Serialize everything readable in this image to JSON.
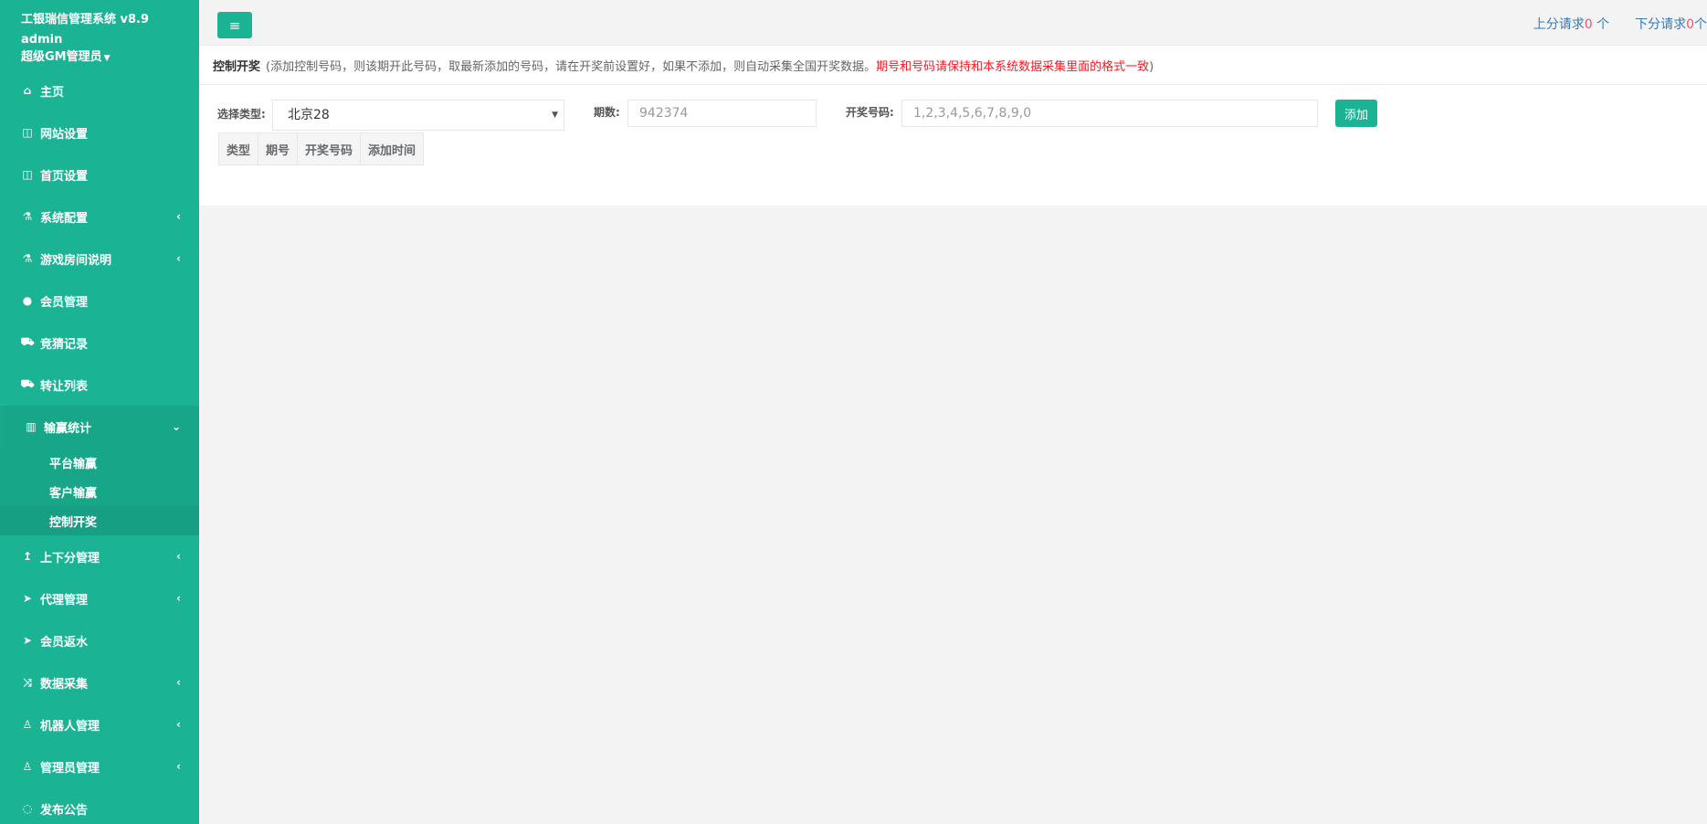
{
  "brand": {
    "title": "工银瑞信管理系统 v8.9",
    "username": "admin",
    "role": "超级GM管理员"
  },
  "sidebar": {
    "items": [
      {
        "label": "主页",
        "icon": "home-icon",
        "glyph": "⌂",
        "arrow": ""
      },
      {
        "label": "网站设置",
        "icon": "columns-icon",
        "glyph": "◫",
        "arrow": ""
      },
      {
        "label": "首页设置",
        "icon": "columns-icon",
        "glyph": "◫",
        "arrow": ""
      },
      {
        "label": "系统配置",
        "icon": "flask-icon",
        "glyph": "⚗",
        "arrow": "‹"
      },
      {
        "label": "游戏房间说明",
        "icon": "flask-icon",
        "glyph": "⚗",
        "arrow": "‹"
      },
      {
        "label": "会员管理",
        "icon": "user-icon",
        "glyph": "●",
        "arrow": ""
      },
      {
        "label": "竞猜记录",
        "icon": "taxi-icon",
        "glyph": "⛟",
        "arrow": ""
      },
      {
        "label": "转让列表",
        "icon": "taxi-icon",
        "glyph": "⛟",
        "arrow": ""
      },
      {
        "label": "输赢统计",
        "icon": "bar-chart-icon",
        "glyph": "▥",
        "arrow": "⌄"
      }
    ],
    "sub_items": [
      {
        "label": "平台输赢"
      },
      {
        "label": "客户输赢"
      },
      {
        "label": "控制开奖"
      }
    ],
    "items_after": [
      {
        "label": "上下分管理",
        "icon": "level-up-icon",
        "glyph": "↥",
        "arrow": "‹"
      },
      {
        "label": "代理管理",
        "icon": "paper-plane-icon",
        "glyph": "➤",
        "arrow": "‹"
      },
      {
        "label": "会员返水",
        "icon": "paper-plane-icon",
        "glyph": "➤",
        "arrow": ""
      },
      {
        "label": "数据采集",
        "icon": "random-icon",
        "glyph": "⤨",
        "arrow": "‹"
      },
      {
        "label": "机器人管理",
        "icon": "male-icon",
        "glyph": "♙",
        "arrow": "‹"
      },
      {
        "label": "管理员管理",
        "icon": "male-icon",
        "glyph": "♙",
        "arrow": "‹"
      },
      {
        "label": "发布公告",
        "icon": "comment-icon",
        "glyph": "◌",
        "arrow": ""
      }
    ]
  },
  "topbar": {
    "menu_icon": "≡",
    "up_label": "上分请求",
    "up_count": "0",
    "up_unit": " 个",
    "down_label": "下分请求",
    "down_count": "0",
    "down_unit": "个"
  },
  "panel": {
    "title": "控制开奖",
    "note_prefix": "(添加控制号码，则该期开此号码，取最新添加的号码，请在开奖前设置好，如果不添加，则自动采集全国开奖数据。",
    "note_warning": "期号和号码请保持和本系统数据采集里面的格式一致",
    "note_suffix": ")"
  },
  "form": {
    "type_label": "选择类型:",
    "type_value": "北京28",
    "issue_label": "期数:",
    "issue_placeholder": "942374",
    "numbers_label": "开奖号码:",
    "numbers_placeholder": "1,2,3,4,5,6,7,8,9,0",
    "add_button": "添加"
  },
  "table": {
    "headers": [
      "类型",
      "期号",
      "开奖号码",
      "添加时间"
    ]
  }
}
